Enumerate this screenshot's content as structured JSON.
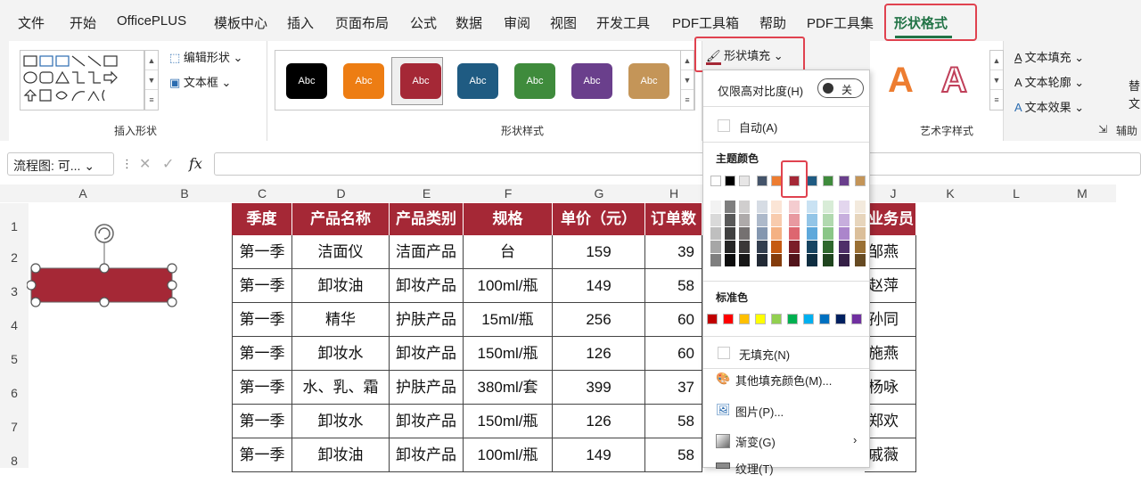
{
  "menu": {
    "items": [
      "文件",
      "开始",
      "OfficePLUS",
      "模板中心",
      "插入",
      "页面布局",
      "公式",
      "数据",
      "审阅",
      "视图",
      "开发工具",
      "PDF工具箱",
      "帮助",
      "PDF工具集"
    ],
    "active": "形状格式"
  },
  "ribbon": {
    "insert_shape_group": "插入形状",
    "edit_shape": "编辑形状",
    "textbox": "文本框",
    "shape_styles_group": "形状样式",
    "style_labels": [
      "Abc",
      "Abc",
      "Abc",
      "Abc",
      "Abc",
      "Abc",
      "Abc"
    ],
    "style_colors": [
      "#000000",
      "#ed7d13",
      "#a52836",
      "#1f5b82",
      "#3f8b3c",
      "#6a3f8c",
      "#c49558"
    ],
    "fill_button": "形状填充",
    "wordart_group": "艺术字样式",
    "text_fill": "文本填充",
    "text_outline": "文本轮廓",
    "text_effect": "文本效果",
    "wordart_a": "A",
    "aux_group": "辅助",
    "edge_label_1": "替",
    "edge_label_2": "文"
  },
  "formula_bar": {
    "name_box": "流程图: 可...",
    "fx": "fx"
  },
  "sheet": {
    "columns": [
      "A",
      "B",
      "C",
      "D",
      "E",
      "F",
      "G",
      "H",
      "",
      "J",
      "K",
      "L",
      "M"
    ],
    "rows": [
      "1",
      "2",
      "3",
      "4",
      "5",
      "6",
      "7",
      "8"
    ],
    "headers": [
      "季度",
      "产品名称",
      "产品类别",
      "规格",
      "单价（元）",
      "订单数",
      "",
      "业务员"
    ],
    "data": [
      [
        "第一季",
        "洁面仪",
        "洁面产品",
        "台",
        "159",
        "39",
        "",
        "邹燕"
      ],
      [
        "第一季",
        "卸妆油",
        "卸妆产品",
        "100ml/瓶",
        "149",
        "58",
        "",
        "赵萍"
      ],
      [
        "第一季",
        "精华",
        "护肤产品",
        "15ml/瓶",
        "256",
        "60",
        "",
        "孙同"
      ],
      [
        "第一季",
        "卸妆水",
        "卸妆产品",
        "150ml/瓶",
        "126",
        "60",
        "",
        "施燕"
      ],
      [
        "第一季",
        "水、乳、霜",
        "护肤产品",
        "380ml/套",
        "399",
        "37",
        "",
        "杨咏"
      ],
      [
        "第一季",
        "卸妆水",
        "卸妆产品",
        "150ml/瓶",
        "126",
        "58",
        "",
        "郑欢"
      ],
      [
        "第一季",
        "卸妆油",
        "卸妆产品",
        "100ml/瓶",
        "149",
        "58",
        "",
        "戚薇"
      ]
    ],
    "header_color": "#a52836"
  },
  "dropdown": {
    "contrast_label": "仅限高对比度(H)",
    "toggle_label": "关",
    "auto": "自动(A)",
    "theme_title": "主题颜色",
    "theme_colors": [
      "#ffffff",
      "#000000",
      "#e7e6e6",
      "#44546a",
      "#ed7d31",
      "#a52836",
      "#1f5b82",
      "#3f8b3c",
      "#6a3f8c",
      "#c49558"
    ],
    "standard_title": "标准色",
    "standard_colors": [
      "#c00000",
      "#ff0000",
      "#ffc000",
      "#ffff00",
      "#92d050",
      "#00b050",
      "#00b0f0",
      "#0070c0",
      "#002060",
      "#7030a0"
    ],
    "no_fill": "无填充(N)",
    "more_colors": "其他填充颜色(M)...",
    "picture": "图片(P)...",
    "gradient": "渐变(G)",
    "texture": "纹理(T)"
  }
}
